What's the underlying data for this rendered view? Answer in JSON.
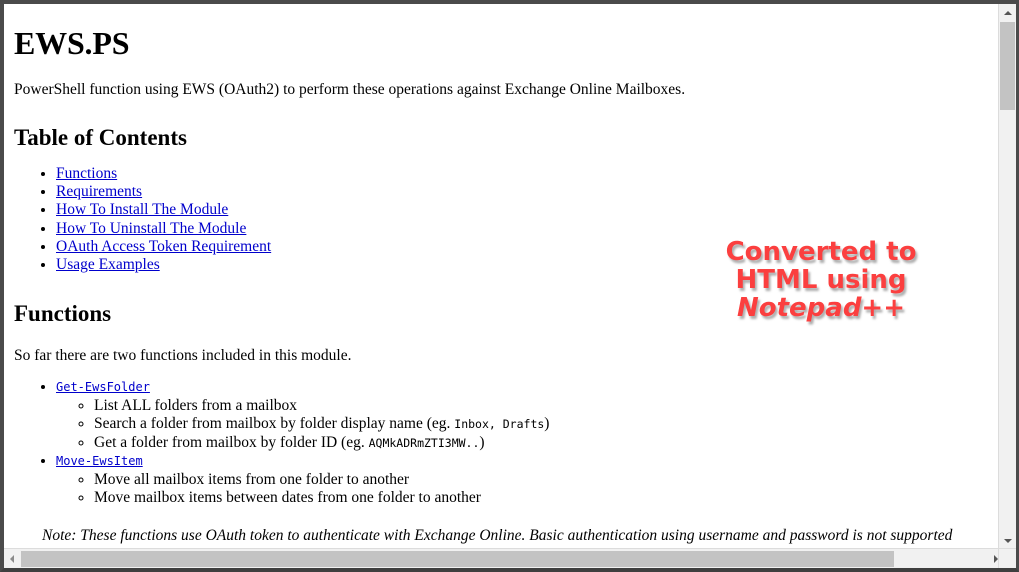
{
  "document": {
    "title": "EWS.PS",
    "intro": "PowerShell function using EWS (OAuth2) to perform these operations against Exchange Online Mailboxes.",
    "toc_heading": "Table of Contents",
    "toc_items": [
      {
        "label": "Functions"
      },
      {
        "label": "Requirements"
      },
      {
        "label": "How To Install The Module"
      },
      {
        "label": "How To Uninstall The Module"
      },
      {
        "label": "OAuth Access Token Requirement"
      },
      {
        "label": "Usage Examples"
      }
    ],
    "functions_heading": "Functions",
    "functions_intro": "So far there are two functions included in this module.",
    "functions": [
      {
        "name": "Get-EwsFolder",
        "items": [
          {
            "text_before": "List ALL folders from a mailbox",
            "code": "",
            "text_after": ""
          },
          {
            "text_before": "Search a folder from mailbox by folder display name (eg. ",
            "code": "Inbox",
            "code2": "Drafts",
            "text_after": ")"
          },
          {
            "text_before": "Get a folder from mailbox by folder ID (eg. ",
            "code": "AQMkADRmZTI3MW..",
            "text_after": ")"
          }
        ]
      },
      {
        "name": "Move-EwsItem",
        "items": [
          {
            "text_before": "Move all mailbox items from one folder to another",
            "code": "",
            "text_after": ""
          },
          {
            "text_before": "Move mailbox items between dates from one folder to another",
            "code": "",
            "text_after": ""
          }
        ]
      }
    ],
    "note": "Note: These functions use OAuth token to authenticate with Exchange Online. Basic authentication using username and password is not supported"
  },
  "watermark": {
    "line1": "Converted to",
    "line2": "HTML using",
    "line3": "Notepad++",
    "color": "#fb3f3f"
  },
  "scrollbars": {
    "vertical_up_icon": "triangle-up-icon",
    "vertical_down_icon": "triangle-down-icon",
    "horizontal_left_icon": "triangle-left-icon",
    "horizontal_right_icon": "triangle-right-icon"
  },
  "separators": {
    "comma": ", "
  }
}
